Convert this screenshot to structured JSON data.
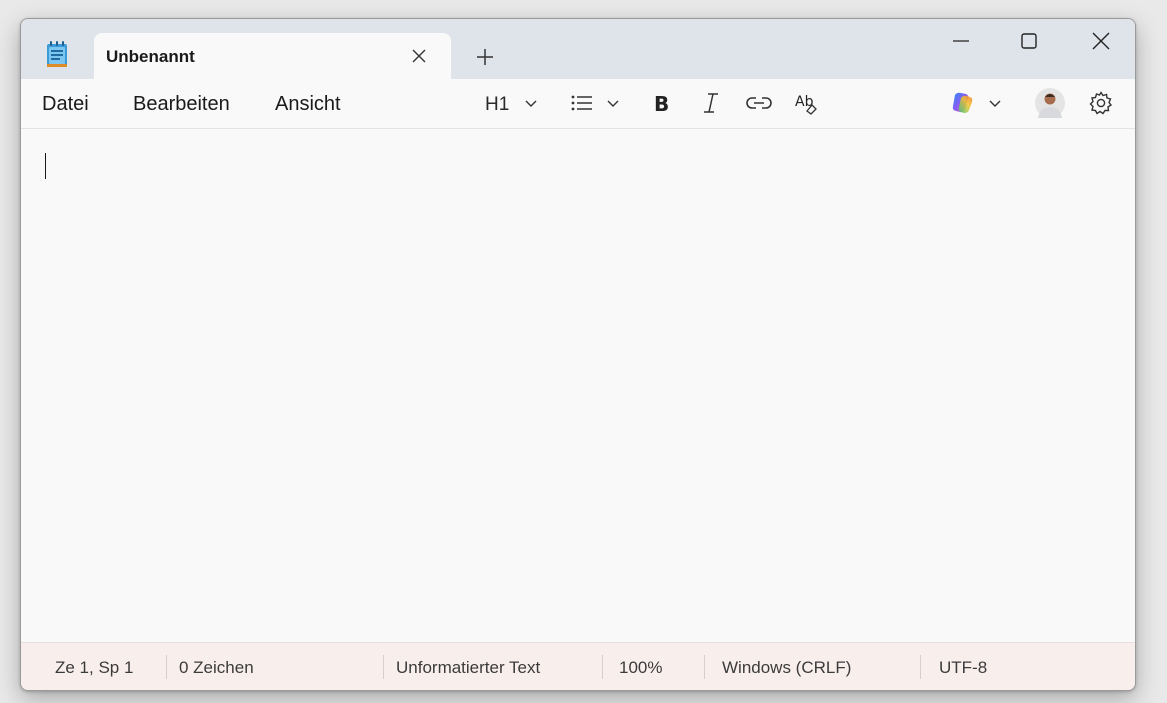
{
  "tab": {
    "title": "Unbenannt"
  },
  "menu": {
    "datei": "Datei",
    "bearbeiten": "Bearbeiten",
    "ansicht": "Ansicht"
  },
  "toolbar": {
    "heading_label": "H1",
    "icons": [
      "heading-dropdown",
      "list-icon",
      "bold-icon",
      "italic-icon",
      "link-icon",
      "spellcheck-icon",
      "copilot-icon",
      "avatar",
      "gear-icon"
    ]
  },
  "status": {
    "position": "Ze 1, Sp 1",
    "chars": "0 Zeichen",
    "format": "Unformatierter Text",
    "zoom": "100%",
    "line_ending": "Windows (CRLF)",
    "encoding": "UTF-8"
  },
  "colors": {
    "titlebar": "#dfe3ea",
    "statusbar": "#f8efed",
    "editor": "#f9f9f9"
  }
}
